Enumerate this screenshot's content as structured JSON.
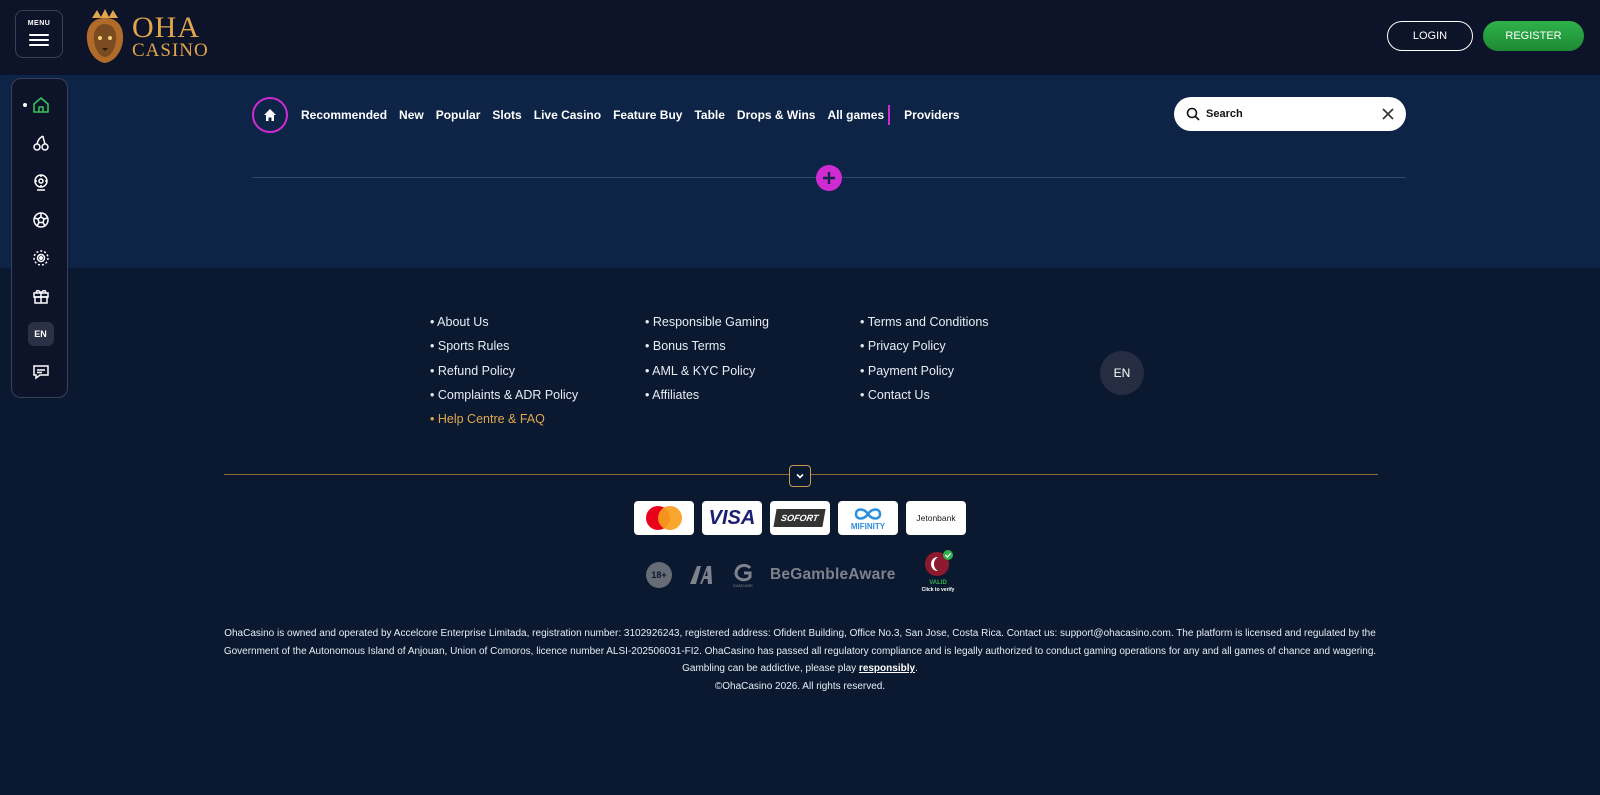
{
  "header": {
    "menu_label": "MENU",
    "logo_line1": "OHA",
    "logo_line2": "CASINO",
    "login_label": "LOGIN",
    "register_label": "REGISTER"
  },
  "sidebar": {
    "lang": "EN"
  },
  "nav": {
    "items": [
      "Recommended",
      "New",
      "Popular",
      "Slots",
      "Live Casino",
      "Feature Buy",
      "Table",
      "Drops & Wins",
      "All games"
    ],
    "providers": "Providers"
  },
  "search": {
    "placeholder": "Search"
  },
  "footer": {
    "col1": [
      "About Us",
      "Sports Rules",
      "Refund Policy",
      "Complaints & ADR Policy",
      "Help Centre & FAQ"
    ],
    "col2": [
      "Responsible Gaming",
      "Bonus Terms",
      "AML & KYC Policy",
      "Affiliates"
    ],
    "col3": [
      "Terms and Conditions",
      "Privacy Policy",
      "Payment Policy",
      "Contact Us"
    ],
    "lang": "EN"
  },
  "payments": {
    "visa": "VISA",
    "sofort": "SOFORT",
    "mifinity": "MIFINITY",
    "jeton": "Jetonbank"
  },
  "badges": {
    "age": "18+",
    "gamcare": "GAMCARE",
    "begamble": "BeGambleAware",
    "valid": "VALID",
    "verify": "Click to verify"
  },
  "legal": {
    "paragraph": "OhaCasino is owned and operated by Accelcore Enterprise Limitada, registration number: 3102926243, registered address: Ofident Building, Office No.3, San Jose, Costa Rica. Contact us: support@ohacasino.com. The platform is licensed and regulated by the Government of the Autonomous Island of Anjouan, Union of Comoros, licence number ALSI-202506031-FI2. OhaCasino has passed all regulatory compliance and is legally authorized to conduct gaming operations for any and all games of chance and wagering.",
    "gambling_prefix": "Gambling can be addictive, please play ",
    "responsibly": "responsibly",
    "gambling_suffix": ".",
    "copyright": "©OhaCasino 2026. All rights reserved."
  },
  "colors": {
    "accent": "#d02bd3",
    "register": "#2fb24a",
    "gold": "#e3a84c"
  }
}
